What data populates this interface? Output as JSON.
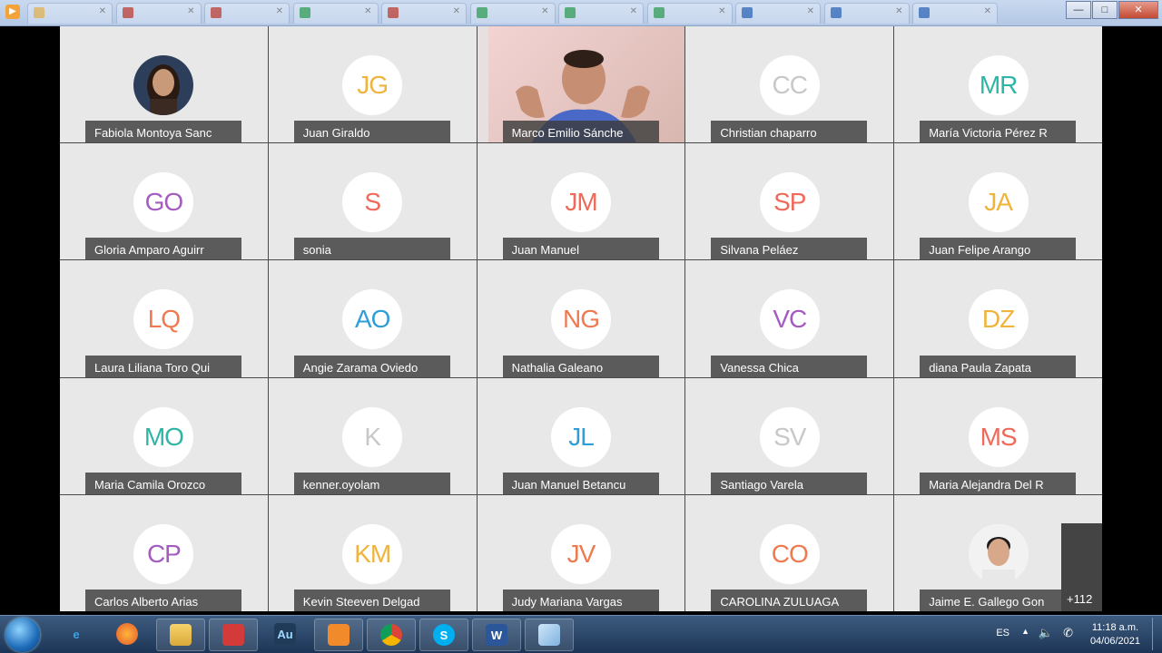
{
  "browser_tabs": [
    {
      "label": "",
      "color": "#e8b44c"
    },
    {
      "label": "",
      "color": "#c0392b"
    },
    {
      "label": "",
      "color": "#c0392b"
    },
    {
      "label": "",
      "color": "#2e9e4f"
    },
    {
      "label": "",
      "color": "#c0392b"
    },
    {
      "label": "",
      "color": "#2e9e4f"
    },
    {
      "label": "",
      "color": "#2e9e4f"
    },
    {
      "label": "",
      "color": "#2e9e4f"
    },
    {
      "label": "",
      "color": "#2a64b4"
    },
    {
      "label": "",
      "color": "#2a64b4"
    },
    {
      "label": "",
      "color": "#2a64b4"
    }
  ],
  "window_buttons": {
    "minimize": "—",
    "maximize": "□",
    "close": "✕"
  },
  "participants": [
    {
      "name": "Fabiola Montoya Sanc",
      "initials": "",
      "color": "",
      "type": "photo-female"
    },
    {
      "name": "Juan Giraldo",
      "initials": "JG",
      "color": "#f0b43c",
      "type": "initials"
    },
    {
      "name": "Marco Emilio Sánche",
      "initials": "",
      "color": "",
      "type": "video"
    },
    {
      "name": "Christian chaparro",
      "initials": "CC",
      "color": "#c8c8c8",
      "type": "initials"
    },
    {
      "name": "María Victoria Pérez R",
      "initials": "MR",
      "color": "#2fb5a5",
      "type": "initials"
    },
    {
      "name": "Gloria Amparo Aguirr",
      "initials": "GO",
      "color": "#a45cc0",
      "type": "initials"
    },
    {
      "name": "sonia",
      "initials": "S",
      "color": "#ef6a5b",
      "type": "initials"
    },
    {
      "name": "Juan Manuel",
      "initials": "JM",
      "color": "#ef6a5b",
      "type": "initials"
    },
    {
      "name": "Silvana Peláez",
      "initials": "SP",
      "color": "#ef6a5b",
      "type": "initials"
    },
    {
      "name": "Juan Felipe Arango",
      "initials": "JA",
      "color": "#f0b43c",
      "type": "initials"
    },
    {
      "name": "Laura Liliana Toro Qui",
      "initials": "LQ",
      "color": "#f07a50",
      "type": "initials"
    },
    {
      "name": "Angie Zarama Oviedo",
      "initials": "AO",
      "color": "#2f9ed8",
      "type": "initials"
    },
    {
      "name": "Nathalia Galeano",
      "initials": "NG",
      "color": "#f07a50",
      "type": "initials"
    },
    {
      "name": "Vanessa Chica",
      "initials": "VC",
      "color": "#a45cc0",
      "type": "initials"
    },
    {
      "name": "diana Paula Zapata",
      "initials": "DZ",
      "color": "#f0b43c",
      "type": "initials"
    },
    {
      "name": "Maria Camila Orozco",
      "initials": "MO",
      "color": "#2fb5a5",
      "type": "initials"
    },
    {
      "name": "kenner.oyolam",
      "initials": "K",
      "color": "#c8c8c8",
      "type": "initials"
    },
    {
      "name": "Juan Manuel Betancu",
      "initials": "JL",
      "color": "#2f9ed8",
      "type": "initials"
    },
    {
      "name": "Santiago Varela",
      "initials": "SV",
      "color": "#c8c8c8",
      "type": "initials"
    },
    {
      "name": "Maria Alejandra Del R",
      "initials": "MS",
      "color": "#ef6a5b",
      "type": "initials"
    },
    {
      "name": "Carlos Alberto Arias",
      "initials": "CP",
      "color": "#a45cc0",
      "type": "initials"
    },
    {
      "name": "Kevin Steeven Delgad",
      "initials": "KM",
      "color": "#f0b43c",
      "type": "initials"
    },
    {
      "name": "Judy Mariana Vargas",
      "initials": "JV",
      "color": "#f07a50",
      "type": "initials"
    },
    {
      "name": "CAROLINA ZULUAGA",
      "initials": "CO",
      "color": "#f07a50",
      "type": "initials"
    },
    {
      "name": "Jaime E. Gallego Gon",
      "initials": "",
      "color": "",
      "type": "photo-male"
    }
  ],
  "overflow_count": "+112",
  "taskbar": {
    "apps": [
      {
        "name": "internet-explorer",
        "glyph": "e"
      },
      {
        "name": "firefox",
        "glyph": ""
      },
      {
        "name": "file-explorer",
        "glyph": ""
      },
      {
        "name": "kill-app",
        "glyph": ""
      },
      {
        "name": "audition",
        "glyph": "Au"
      },
      {
        "name": "media-player",
        "glyph": ""
      },
      {
        "name": "chrome",
        "glyph": ""
      },
      {
        "name": "skype",
        "glyph": "S"
      },
      {
        "name": "word",
        "glyph": "W"
      },
      {
        "name": "document-app",
        "glyph": ""
      }
    ],
    "language": "ES",
    "time": "11:18 a.m.",
    "date": "04/06/2021"
  }
}
